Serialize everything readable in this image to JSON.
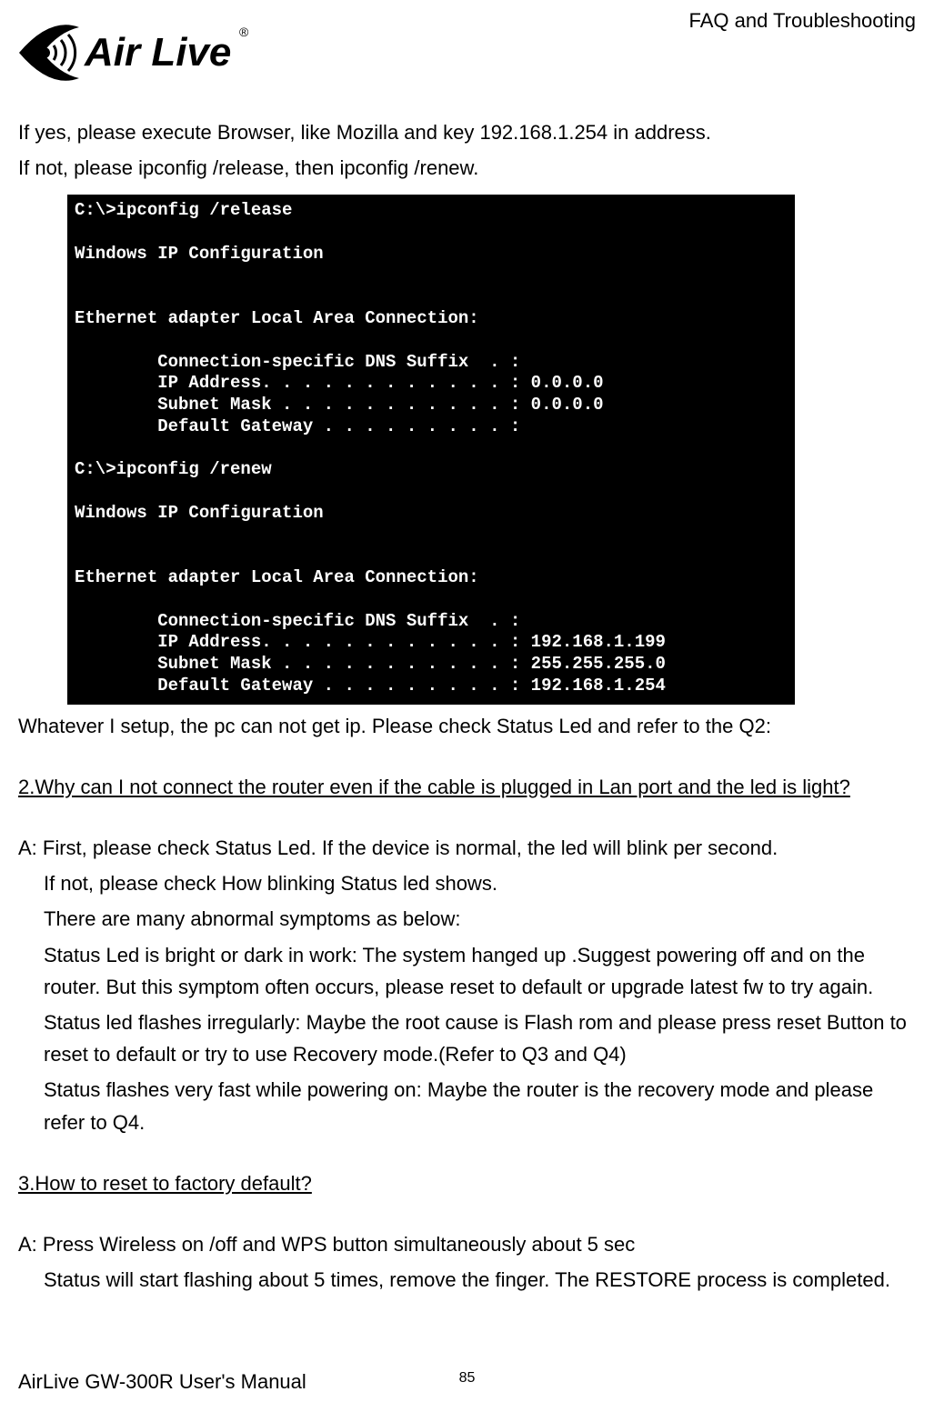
{
  "header": {
    "section_title": "FAQ and Troubleshooting",
    "logo_text": "Air Live",
    "logo_registered": "®"
  },
  "intro": {
    "line1": "If yes, please execute Browser, like Mozilla and key 192.168.1.254 in address.",
    "line2": "If not, please ipconfig /release, then ipconfig /renew."
  },
  "terminal_text": "C:\\>ipconfig /release\n\nWindows IP Configuration\n\n\nEthernet adapter Local Area Connection:\n\n        Connection-specific DNS Suffix  . :\n        IP Address. . . . . . . . . . . . : 0.0.0.0\n        Subnet Mask . . . . . . . . . . . : 0.0.0.0\n        Default Gateway . . . . . . . . . :\n\nC:\\>ipconfig /renew\n\nWindows IP Configuration\n\n\nEthernet adapter Local Area Connection:\n\n        Connection-specific DNS Suffix  . :\n        IP Address. . . . . . . . . . . . : 192.168.1.199\n        Subnet Mask . . . . . . . . . . . : 255.255.255.0\n        Default Gateway . . . . . . . . . : 192.168.1.254",
  "post_terminal": "Whatever I setup, the pc can not get ip. Please check Status Led and refer to the Q2:",
  "q2": {
    "question": "2.Why can I not connect the router even if the cable is plugged in Lan port and the led is light?",
    "a_line1": "A: First, please check Status Led. If the device is normal, the led will blink per second.",
    "a_line2": "If not, please check How blinking Status led shows.",
    "a_line3": "There are many abnormal symptoms as below:",
    "a_line4": "Status Led is bright or dark in work: The system hanged up .Suggest powering off and on the router. But this symptom often occurs, please reset to default or upgrade latest fw to try again.",
    "a_line5": "Status led flashes irregularly: Maybe the root cause is Flash rom and please press reset Button to reset to default or try to use Recovery mode.(Refer to Q3 and Q4)",
    "a_line6": "Status flashes very fast while powering on: Maybe the router is the recovery mode and please refer to Q4."
  },
  "q3": {
    "question": "3.How to reset to factory default?",
    "a_line1": "A: Press Wireless on /off and WPS button simultaneously about 5 sec",
    "a_line2": "Status will start flashing about 5 times, remove the finger. The RESTORE process is completed."
  },
  "footer": {
    "manual": "AirLive GW-300R User's Manual",
    "page_number": "85"
  }
}
